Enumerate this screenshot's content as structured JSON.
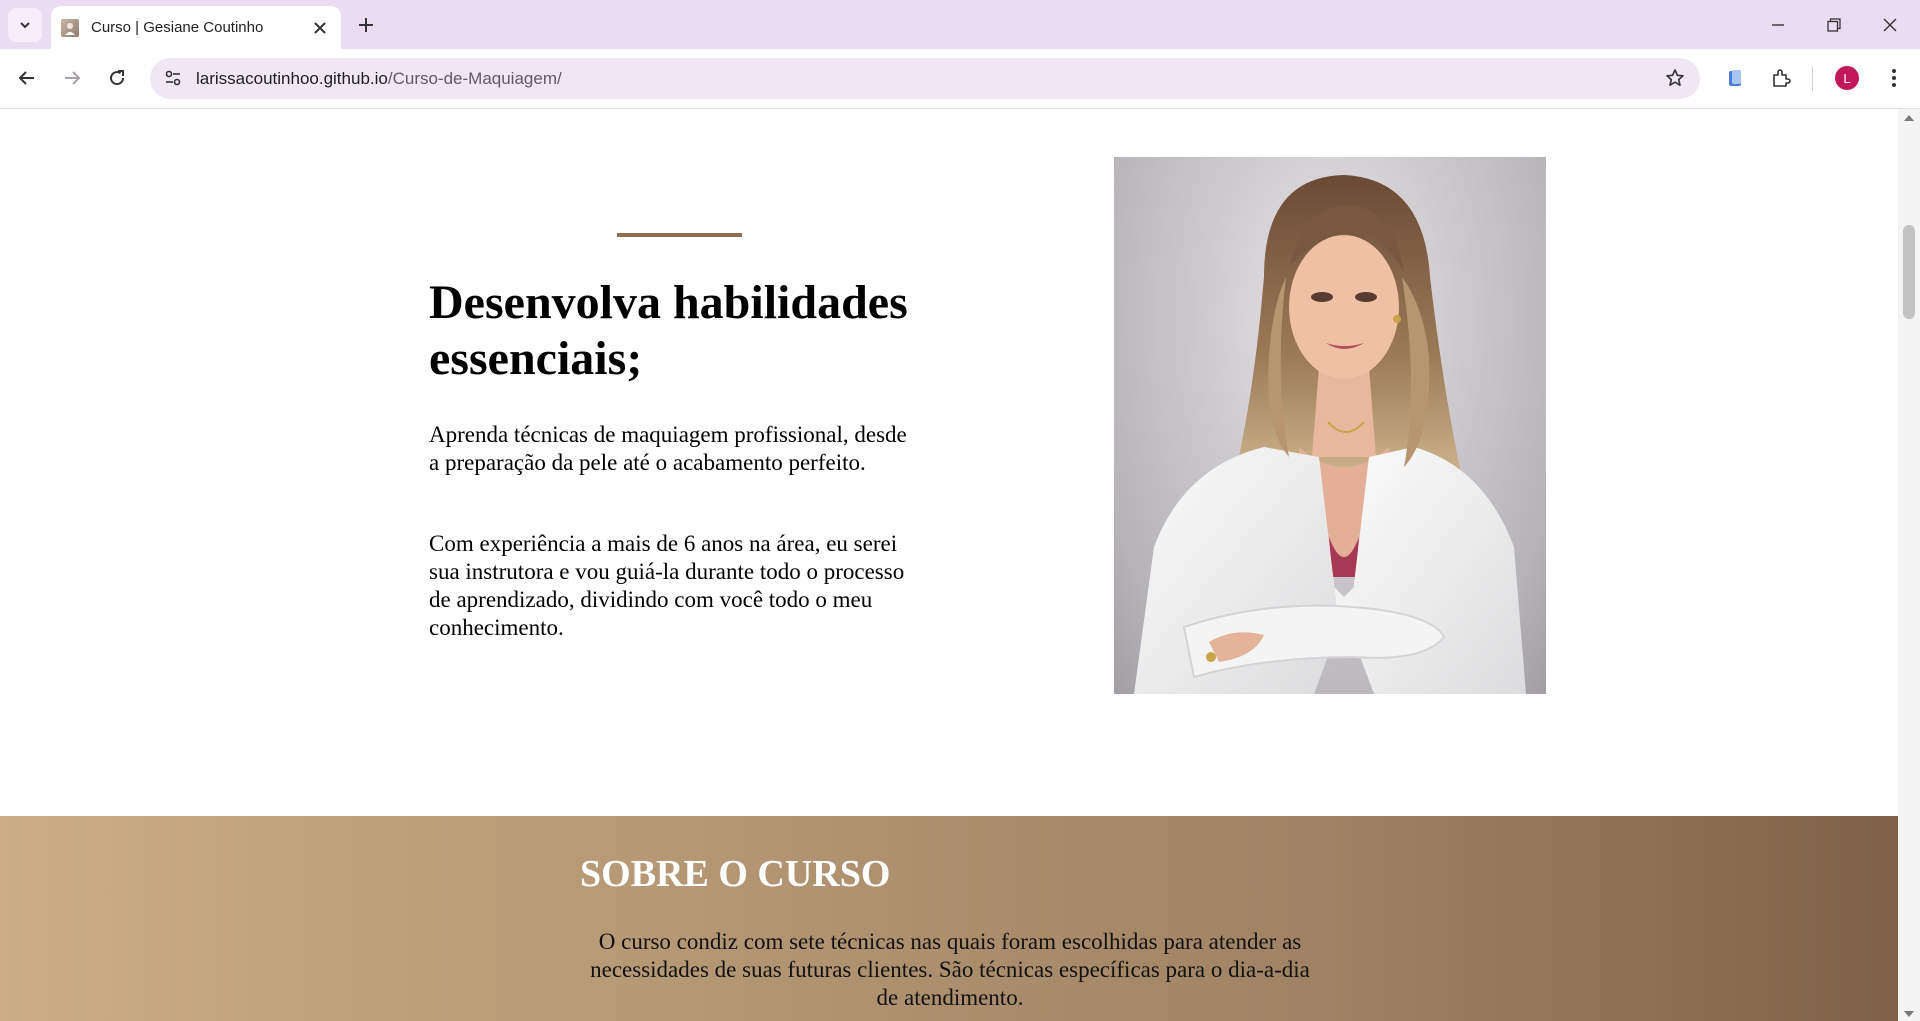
{
  "browser": {
    "tab_title": "Curso | Gesiane Coutinho",
    "url_host": "larissacoutinhoo.github.io",
    "url_path": "/Curso-de-Maquiagem/",
    "profile_initial": "L",
    "accent_color": "#c2185b"
  },
  "hero": {
    "title": "Desenvolva habilidades essenciais;",
    "paragraph1": "Aprenda técnicas de maquiagem profissional, desde a preparação da pele até o acabamento perfeito.",
    "paragraph2": "Com experiência a mais de 6 anos na área, eu serei sua instrutora e vou guiá-la durante todo o processo de aprendizado, dividindo com você todo o meu conhecimento.",
    "accent_color": "#8b6f4e"
  },
  "about": {
    "title": "SOBRE O CURSO",
    "text": "O curso condiz com sete técnicas nas quais foram escolhidas para atender as necessidades de suas futuras clientes. São técnicas específicas para o dia-a-dia de atendimento.",
    "gradient_start": "#cbac84",
    "gradient_end": "#7d6247"
  }
}
